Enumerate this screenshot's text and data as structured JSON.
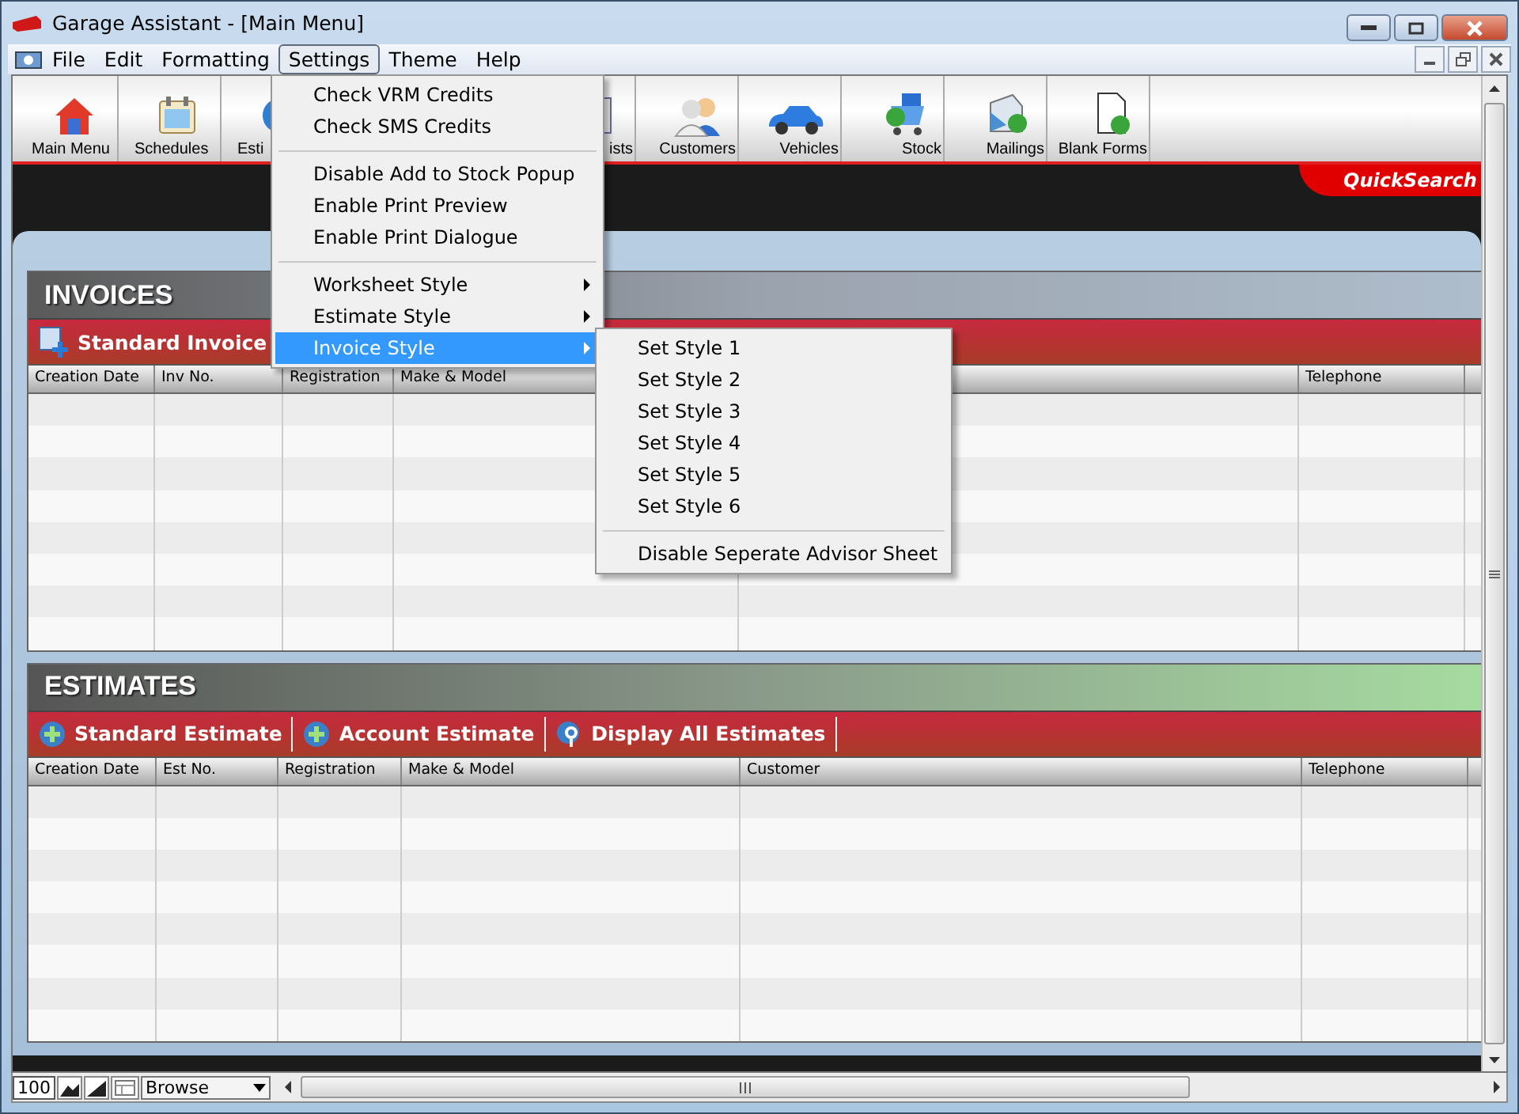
{
  "window": {
    "title": "Garage Assistant - [Main Menu]"
  },
  "menu_bar": [
    {
      "label": "File",
      "selected": false
    },
    {
      "label": "Edit",
      "selected": false
    },
    {
      "label": "Formatting",
      "selected": false
    },
    {
      "label": "Settings",
      "selected": true
    },
    {
      "label": "Theme",
      "selected": false
    },
    {
      "label": "Help",
      "selected": false
    }
  ],
  "toolbar": {
    "left_items": [
      {
        "label": "Main Menu",
        "kind": "house"
      },
      {
        "label": "Schedules",
        "kind": "calendar"
      },
      {
        "label": "Esti",
        "kind": "globe"
      }
    ],
    "right_items": [
      {
        "label": "ists",
        "kind": "list"
      },
      {
        "label": "Customers",
        "kind": "people"
      },
      {
        "label": "Vehicles",
        "kind": "car"
      },
      {
        "label": "Stock",
        "kind": "cart"
      },
      {
        "label": "Mailings",
        "kind": "mail"
      },
      {
        "label": "Blank Forms",
        "kind": "form"
      }
    ]
  },
  "quick_search": {
    "label": "QuickSearch"
  },
  "invoices": {
    "title": "INVOICES",
    "actions": [
      {
        "label": "Standard Invoice",
        "kind": "invoice"
      }
    ],
    "columns": [
      {
        "label": "Creation Date"
      },
      {
        "label": "Inv No."
      },
      {
        "label": "Registration"
      },
      {
        "label": "Make & Model"
      },
      {
        "label": "Telephone"
      }
    ]
  },
  "estimates": {
    "title": "ESTIMATES",
    "actions": [
      {
        "label": "Standard Estimate",
        "kind": "add"
      },
      {
        "label": "Account Estimate",
        "kind": "add"
      },
      {
        "label": "Display All Estimates",
        "kind": "search"
      }
    ],
    "columns": [
      {
        "label": "Creation Date"
      },
      {
        "label": "Est No."
      },
      {
        "label": "Registration"
      },
      {
        "label": "Make & Model"
      },
      {
        "label": "Customer"
      },
      {
        "label": "Telephone"
      }
    ]
  },
  "status_bar": {
    "zoom": "100",
    "mode": "Browse"
  },
  "settings_menu": {
    "groups": [
      [
        {
          "label": "Check VRM Credits",
          "submenu": false,
          "selected": false
        },
        {
          "label": "Check SMS Credits",
          "submenu": false,
          "selected": false
        }
      ],
      [
        {
          "label": "Disable Add to Stock Popup",
          "submenu": false,
          "selected": false
        },
        {
          "label": "Enable Print Preview",
          "submenu": false,
          "selected": false
        },
        {
          "label": "Enable Print Dialogue",
          "submenu": false,
          "selected": false
        }
      ],
      [
        {
          "label": "Worksheet Style",
          "submenu": true,
          "selected": false
        },
        {
          "label": "Estimate Style",
          "submenu": true,
          "selected": false
        },
        {
          "label": "Invoice Style",
          "submenu": true,
          "selected": true
        }
      ]
    ]
  },
  "invoice_style_menu": {
    "groups": [
      [
        {
          "label": "Set Style 1",
          "submenu": false,
          "selected": false
        },
        {
          "label": "Set Style 2",
          "submenu": false,
          "selected": false
        },
        {
          "label": "Set Style 3",
          "submenu": false,
          "selected": false
        },
        {
          "label": "Set Style 4",
          "submenu": false,
          "selected": false
        },
        {
          "label": "Set Style 5",
          "submenu": false,
          "selected": false
        },
        {
          "label": "Set Style 6",
          "submenu": false,
          "selected": false
        }
      ],
      [
        {
          "label": "Disable Seperate Advisor Sheet",
          "submenu": false,
          "selected": false
        }
      ]
    ]
  }
}
